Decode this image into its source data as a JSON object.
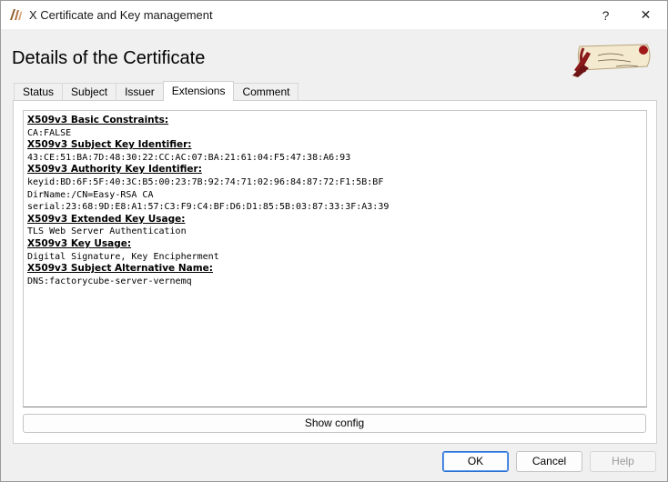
{
  "window": {
    "title": "X Certificate and Key management",
    "help_glyph": "?",
    "close_glyph": "✕"
  },
  "page_title": "Details of the Certificate",
  "tabs": [
    {
      "label": "Status",
      "active": false
    },
    {
      "label": "Subject",
      "active": false
    },
    {
      "label": "Issuer",
      "active": false
    },
    {
      "label": "Extensions",
      "active": true
    },
    {
      "label": "Comment",
      "active": false
    }
  ],
  "extensions": [
    {
      "heading": "X509v3 Basic Constraints:",
      "values": [
        "CA:FALSE"
      ]
    },
    {
      "heading": "X509v3 Subject Key Identifier:",
      "values": [
        "43:CE:51:BA:7D:48:30:22:CC:AC:07:BA:21:61:04:F5:47:38:A6:93"
      ]
    },
    {
      "heading": "X509v3 Authority Key Identifier:",
      "values": [
        "keyid:BD:6F:5F:40:3C:B5:00:23:7B:92:74:71:02:96:84:87:72:F1:5B:BF",
        "DirName:/CN=Easy-RSA CA",
        "serial:23:68:9D:E8:A1:57:C3:F9:C4:BF:D6:D1:85:5B:03:87:33:3F:A3:39"
      ]
    },
    {
      "heading": "X509v3 Extended Key Usage:",
      "values": [
        "TLS Web Server Authentication"
      ]
    },
    {
      "heading": "X509v3 Key Usage:",
      "values": [
        "Digital Signature, Key Encipherment"
      ]
    },
    {
      "heading": "X509v3 Subject Alternative Name:",
      "values": [
        "DNS:factorycube-server-vernemq"
      ]
    }
  ],
  "buttons": {
    "show_config": "Show config",
    "ok": "OK",
    "cancel": "Cancel",
    "help": "Help"
  },
  "colors": {
    "ok_border": "#2b6fd1",
    "logo_ribbon": "#8b1a1a"
  },
  "icons": {
    "app": "xca-app-icon",
    "logo": "xca-parchment-logo"
  }
}
